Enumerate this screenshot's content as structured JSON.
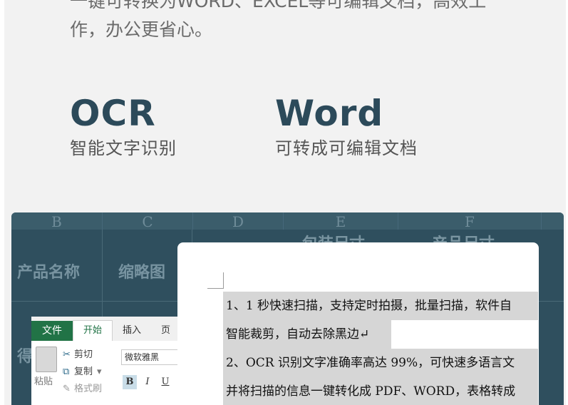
{
  "intro": {
    "line1": "一键可转换为WORD、EXCEL等可编辑文档，高效工",
    "line2": "作，办公更省心。"
  },
  "features": [
    {
      "title": "OCR",
      "subtitle": "智能文字识别"
    },
    {
      "title": "Word",
      "subtitle": "可转成可编辑文档"
    }
  ],
  "spreadsheet": {
    "columns": [
      "B",
      "C",
      "D",
      "E",
      "F"
    ],
    "cells": [
      "产品名称",
      "缩略图"
    ],
    "hidden_headers": [
      "包装尺寸",
      "产品尺寸"
    ],
    "row_fragment": "得"
  },
  "excel_ribbon": {
    "tabs": [
      "文件",
      "开始",
      "插入",
      "页"
    ],
    "active_tab": "开始",
    "paste": "粘贴",
    "cut": "剪切",
    "copy": "复制",
    "format_painter": "格式刷",
    "font": "微软雅黑",
    "bold": "B",
    "italic": "I",
    "underline": "U",
    "accent": "#217346"
  },
  "document": {
    "line1": "1、1 秒快速扫描，支持定时拍摄，批量扫描，软件自",
    "line2": "智能裁剪，自动去除黑边↵",
    "line3": "2、OCR 识别文字准确率高达 99%，可快速多语言文",
    "line4": "并将扫描的信息一键转化成 PDF、WORD，表格转成"
  }
}
